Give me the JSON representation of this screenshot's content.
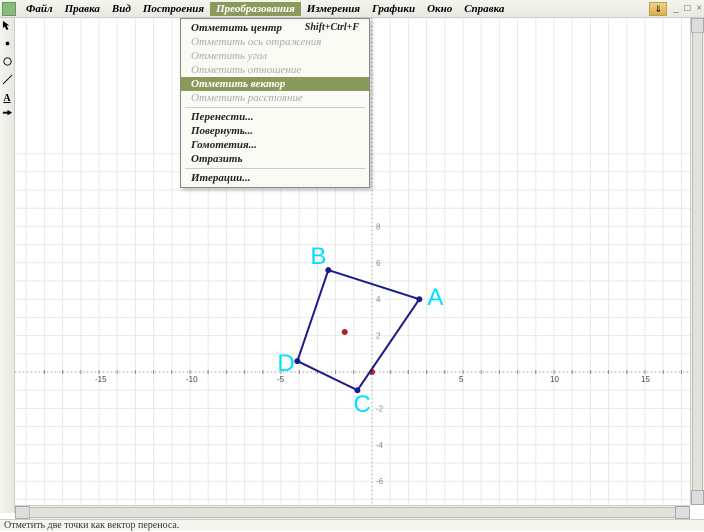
{
  "menubar": {
    "items": [
      "Файл",
      "Правка",
      "Вид",
      "Построения",
      "Преобразования",
      "Измерения",
      "Графики",
      "Окно",
      "Справка"
    ],
    "active_index": 4
  },
  "dropdown": {
    "items": [
      {
        "label": "Отметить центр",
        "shortcut": "Shift+Ctrl+F",
        "enabled": true
      },
      {
        "label": "Отметить ось отражения",
        "enabled": false
      },
      {
        "label": "Отметить угол",
        "enabled": false
      },
      {
        "label": "Отметить отношение",
        "enabled": false
      },
      {
        "label": "Отметить вектор",
        "enabled": true,
        "highlight": true
      },
      {
        "label": "Отметить расстояние",
        "enabled": false
      },
      {
        "sep": true
      },
      {
        "label": "Перенести...",
        "enabled": true
      },
      {
        "label": "Повернуть...",
        "enabled": true
      },
      {
        "label": "Гомотетия...",
        "enabled": true
      },
      {
        "label": "Отразить",
        "enabled": true
      },
      {
        "sep": true
      },
      {
        "label": "Итерации...",
        "enabled": true
      }
    ]
  },
  "tools": [
    "arrow",
    "point",
    "circle",
    "line",
    "text",
    "custom"
  ],
  "chart_data": {
    "type": "scatter",
    "title": "",
    "xlabel": "",
    "ylabel": "",
    "xlim": [
      -18,
      18
    ],
    "ylim": [
      -10,
      10
    ],
    "xticks_major": [
      -15,
      -10,
      -5,
      5,
      10,
      15
    ],
    "yticks_major": [
      -6,
      -4,
      -2,
      2,
      4,
      6,
      8
    ],
    "grid": true,
    "origin_marker": {
      "x": 0,
      "y": 0
    },
    "free_point": {
      "x": -1.5,
      "y": 2.2,
      "color": "#b02020"
    },
    "polygon": {
      "vertices": [
        {
          "label": "A",
          "x": 2.6,
          "y": 4.0
        },
        {
          "label": "B",
          "x": -2.4,
          "y": 5.6
        },
        {
          "label": "C",
          "x": -0.8,
          "y": -1.0
        },
        {
          "label": "D",
          "x": -4.1,
          "y": 0.6
        }
      ],
      "edges": [
        [
          "A",
          "B"
        ],
        [
          "B",
          "D"
        ],
        [
          "D",
          "C"
        ],
        [
          "C",
          "A"
        ]
      ],
      "stroke": "#1a1a8a"
    }
  },
  "status": "Отметить две точки как вектор переноса.",
  "win": {
    "min": "_",
    "max": "□",
    "close": "×"
  }
}
